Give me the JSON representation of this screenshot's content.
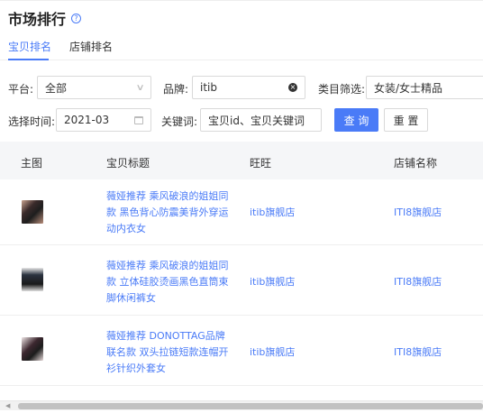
{
  "page": {
    "title": "市场排行"
  },
  "tabs": [
    {
      "label": "宝贝排名",
      "active": true
    },
    {
      "label": "店铺排名",
      "active": false
    }
  ],
  "filters": {
    "platform_label": "平台:",
    "platform_value": "全部",
    "brand_label": "品牌:",
    "brand_value": "itib",
    "category_label": "类目筛选:",
    "category_value": "女装/女士精品",
    "time_label": "选择时间:",
    "time_value": "2021-03",
    "keyword_label": "关键词:",
    "keyword_placeholder": "宝贝id、宝贝关键词",
    "search_label": "查 询",
    "reset_label": "重 置"
  },
  "table": {
    "headers": [
      "主图",
      "宝贝标题",
      "旺旺",
      "店铺名称"
    ],
    "rows": [
      {
        "title": "薇娅推荐 乘风破浪的姐姐同款 黑色背心防震美背外穿运动内衣女",
        "wangwang": "itib旗舰店",
        "shop": "ITI8旗舰店",
        "thumb_color": "#3a2a2a"
      },
      {
        "title": "薇娅推荐 乘风破浪的姐姐同款 立体硅胶烫画黑色直筒束脚休闲裤女",
        "wangwang": "itib旗舰店",
        "shop": "ITI8旗舰店",
        "thumb_color": "#2b3340"
      },
      {
        "title": "薇娅推荐 DONOTTAG品牌联名款 双头拉链短款连帽开衫针织外套女",
        "wangwang": "itib旗舰店",
        "shop": "ITI8旗舰店",
        "thumb_color": "#3d2830"
      }
    ]
  },
  "colors": {
    "accent": "#4a7bf7"
  }
}
